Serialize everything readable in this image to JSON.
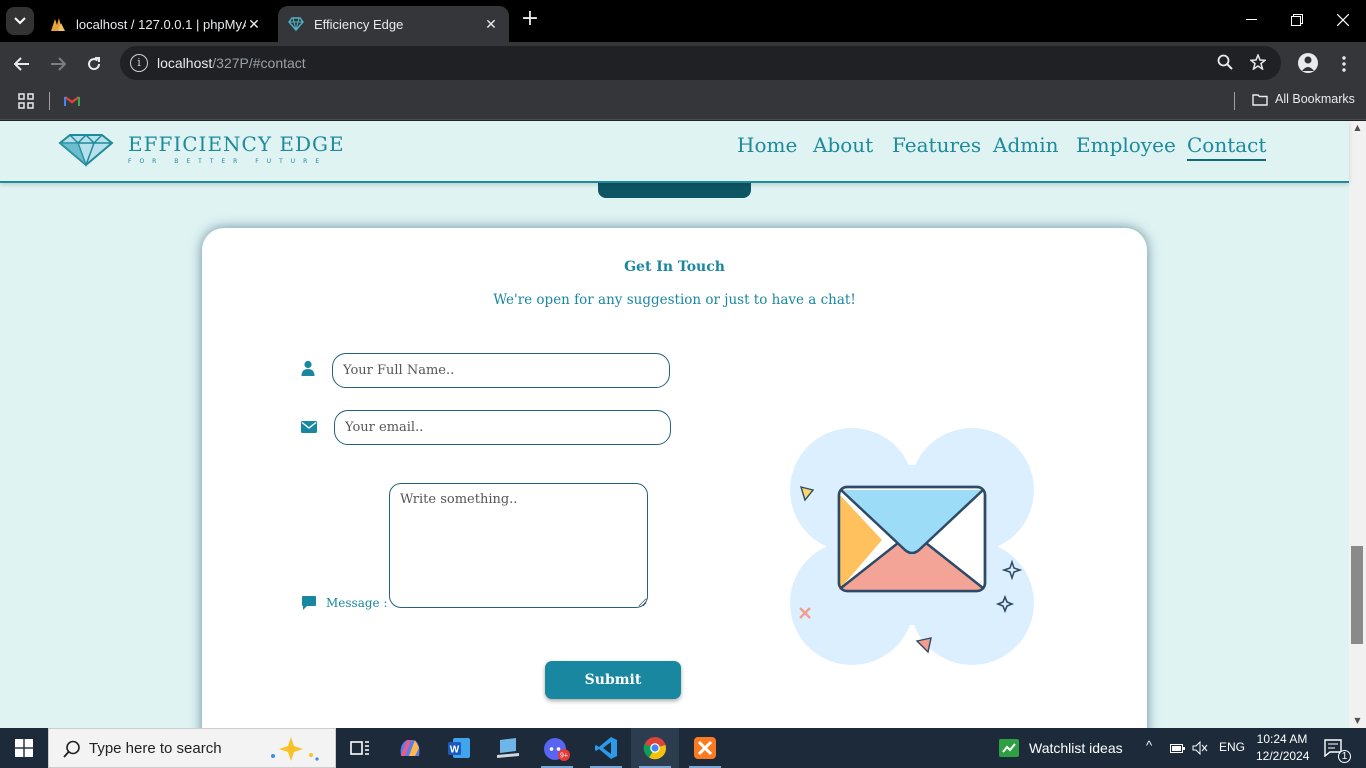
{
  "browser": {
    "tabs": [
      {
        "title": "localhost / 127.0.0.1 | phpMyAdmin",
        "active": false
      },
      {
        "title": "Efficiency Edge",
        "active": true
      }
    ],
    "url_host": "localhost",
    "url_path": "/327P/#contact",
    "bookmarks": {
      "all_label": "All Bookmarks"
    }
  },
  "site": {
    "logo_name": "EFFICIENCY EDGE",
    "logo_tagline": "FOR BETTER FUTURE",
    "nav": [
      {
        "label": "Home"
      },
      {
        "label": "About"
      },
      {
        "label": "Features"
      },
      {
        "label": "Admin"
      },
      {
        "label": "Employee"
      },
      {
        "label": "Contact",
        "current": true
      }
    ],
    "brand_color": "#1a87a0",
    "page_bg": "#dff3f3"
  },
  "contact": {
    "title": "Get In Touch",
    "subtitle": "We're open for any suggestion or just to have a chat!",
    "name_placeholder": "Your Full Name..",
    "email_placeholder": "Your email..",
    "message_placeholder": "Write something..",
    "message_label": "Message :",
    "submit_label": "Submit"
  },
  "taskbar": {
    "search_placeholder": "Type here to search",
    "widget_label": "Watchlist ideas",
    "language": "ENG",
    "time": "10:24 AM",
    "date": "12/2/2024",
    "notification_count": "1",
    "discord_badge": "9+"
  }
}
